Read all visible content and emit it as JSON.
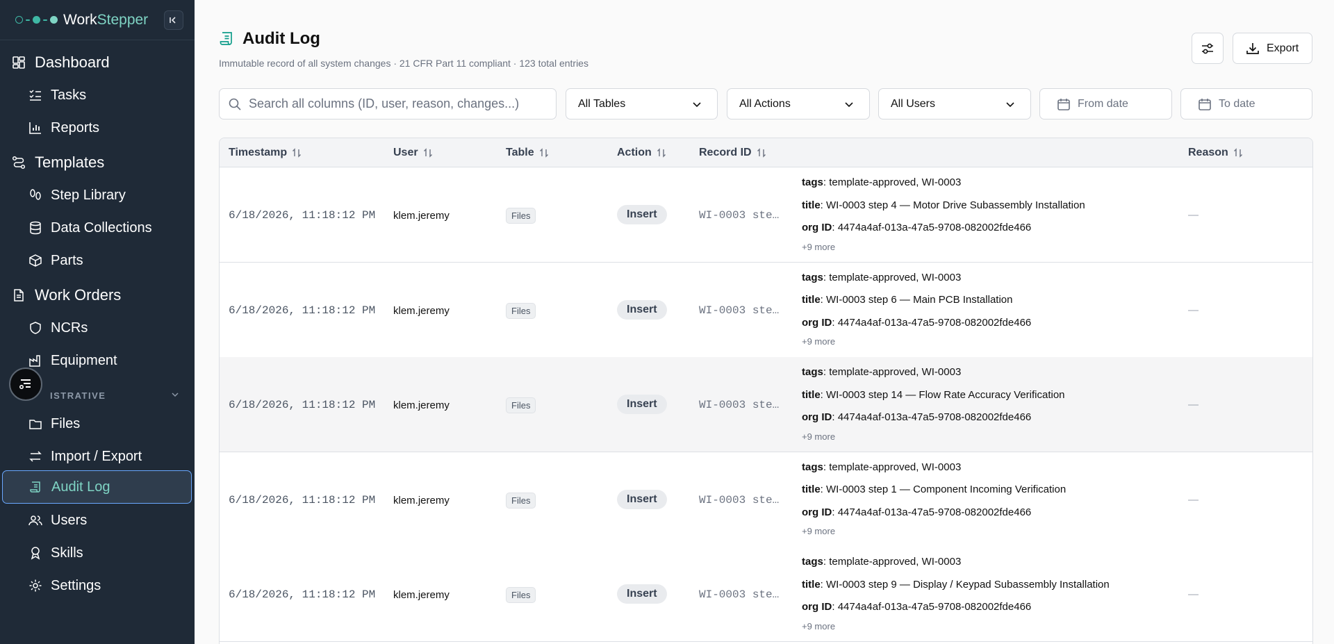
{
  "brand": {
    "part1": "Work",
    "part2": "Stepper"
  },
  "colors": {
    "sidebar_bg": "#1f2a37",
    "accent": "#7fd4c4",
    "active_border": "#6aa8ff"
  },
  "sidebar": {
    "items": [
      {
        "label": "Dashboard",
        "icon": "dashboard-icon",
        "level": 1
      },
      {
        "label": "Tasks",
        "icon": "task-list-icon",
        "level": 2
      },
      {
        "label": "Reports",
        "icon": "bar-chart-icon",
        "level": 2
      },
      {
        "label": "Templates",
        "icon": "workflow-icon",
        "level": 1
      },
      {
        "label": "Step Library",
        "icon": "footprints-icon",
        "level": 2
      },
      {
        "label": "Data Collections",
        "icon": "database-icon",
        "level": 2
      },
      {
        "label": "Parts",
        "icon": "package-icon",
        "level": 2
      },
      {
        "label": "Work Orders",
        "icon": "document-icon",
        "level": 1
      },
      {
        "label": "NCRs",
        "icon": "shield-icon",
        "level": 2
      },
      {
        "label": "Equipment",
        "icon": "factory-icon",
        "level": 2
      },
      {
        "label": "Files",
        "icon": "folder-icon",
        "level": 2
      },
      {
        "label": "Import / Export",
        "icon": "arrows-swap-icon",
        "level": 2
      },
      {
        "label": "Audit Log",
        "icon": "scroll-icon",
        "level": 2,
        "active": true
      },
      {
        "label": "Users",
        "icon": "users-icon",
        "level": 2
      },
      {
        "label": "Skills",
        "icon": "award-icon",
        "level": 2
      },
      {
        "label": "Settings",
        "icon": "gear-icon",
        "level": 2
      }
    ],
    "section_label": "ISTRATIVE"
  },
  "header": {
    "title": "Audit Log",
    "subtitle": "Immutable record of all system changes · 21 CFR Part 11 compliant · 123 total entries",
    "export_label": "Export"
  },
  "filters": {
    "search_placeholder": "Search all columns (ID, user, reason, changes...)",
    "tables": "All Tables",
    "actions": "All Actions",
    "users": "All Users",
    "from_date": "From date",
    "to_date": "To date"
  },
  "table": {
    "columns": [
      "Timestamp",
      "User",
      "Table",
      "Action",
      "Record ID",
      "Reason"
    ],
    "rows": [
      {
        "timestamp": "6/18/2026, 11:18:12 PM",
        "user": "klem.jeremy",
        "table": "Files",
        "action": "Insert",
        "record_id": "WI-0003 ste…",
        "tags": "template-approved, WI-0003",
        "title": "WI-0003 step 4 — Motor Drive Subassembly Installation",
        "org_id": "4474a4af-013a-47a5-9708-082002fde466",
        "more": "+9 more",
        "reason": "—"
      },
      {
        "timestamp": "6/18/2026, 11:18:12 PM",
        "user": "klem.jeremy",
        "table": "Files",
        "action": "Insert",
        "record_id": "WI-0003 ste…",
        "tags": "template-approved, WI-0003",
        "title": "WI-0003 step 6 — Main PCB Installation",
        "org_id": "4474a4af-013a-47a5-9708-082002fde466",
        "more": "+9 more",
        "reason": "—"
      },
      {
        "timestamp": "6/18/2026, 11:18:12 PM",
        "user": "klem.jeremy",
        "table": "Files",
        "action": "Insert",
        "record_id": "WI-0003 ste…",
        "tags": "template-approved, WI-0003",
        "title": "WI-0003 step 14 — Flow Rate Accuracy Verification",
        "org_id": "4474a4af-013a-47a5-9708-082002fde466",
        "more": "+9 more",
        "reason": "—"
      },
      {
        "timestamp": "6/18/2026, 11:18:12 PM",
        "user": "klem.jeremy",
        "table": "Files",
        "action": "Insert",
        "record_id": "WI-0003 ste…",
        "tags": "template-approved, WI-0003",
        "title": "WI-0003 step 1 — Component Incoming Verification",
        "org_id": "4474a4af-013a-47a5-9708-082002fde466",
        "more": "+9 more",
        "reason": "—"
      },
      {
        "timestamp": "6/18/2026, 11:18:12 PM",
        "user": "klem.jeremy",
        "table": "Files",
        "action": "Insert",
        "record_id": "WI-0003 ste…",
        "tags": "template-approved, WI-0003",
        "title": "WI-0003 step 9 — Display / Keypad Subassembly Installation",
        "org_id": "4474a4af-013a-47a5-9708-082002fde466",
        "more": "+9 more",
        "reason": "—"
      }
    ],
    "field_labels": {
      "tags": "tags",
      "title": "title",
      "org_id": "org ID"
    }
  }
}
